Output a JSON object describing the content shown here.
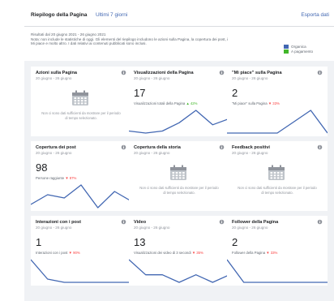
{
  "header": {
    "title": "Riepilogo della Pagina",
    "range": "Ultimi 7 giorni",
    "export": "Esporta dati"
  },
  "info": {
    "dates": "Risultati dal 20 giugno 2021 - 26 giugno 2021",
    "note": "Nota: non include le statistiche di oggi. Gli elementi del riepilogo includono le azioni sulla Pagina, la copertura dei post, i Mi piace e molto altro. I dati relativi ai contenuti pubblicati sono inclusi.",
    "legend_organic": "Organica",
    "legend_paid": "A pagamento",
    "color_organic": "#4267b2",
    "color_paid": "#42b72a"
  },
  "cards": [
    {
      "title": "Azioni sulla Pagina",
      "sub": "20 giugno - 26 giugno",
      "type": "empty",
      "empty_text": "Non ci sono dati sufficienti da mostrare per il periodo di tempo selezionato.",
      "trend": []
    },
    {
      "title": "Visualizzazioni della Pagina",
      "sub": "20 giugno - 26 giugno",
      "type": "value",
      "value": "17",
      "change_label": "Visualizzazioni totali della Pagina",
      "change_pct": "▲ 42%",
      "direction": "up",
      "trend": [
        6,
        5,
        6,
        10,
        16,
        9,
        12
      ]
    },
    {
      "title": "\"Mi piace\" sulla Pagina",
      "sub": "20 giugno - 26 giugno",
      "type": "value",
      "value": "2",
      "change_label": "\"Mi piace\" sulla Pagina",
      "change_pct": "▼ 33%",
      "direction": "down",
      "trend": [
        0,
        0,
        0,
        0,
        3,
        6,
        0
      ]
    },
    {
      "title": "Copertura dei post",
      "sub": "20 giugno - 26 giugno",
      "type": "value",
      "value": "98",
      "change_label": "Persone raggiunte",
      "change_pct": "▼ 87%",
      "direction": "down",
      "trend": [
        5,
        8,
        7,
        11,
        4,
        9,
        6
      ]
    },
    {
      "title": "Copertura della storia",
      "sub": "20 giugno - 26 giugno",
      "type": "empty",
      "empty_text": "Non ci sono dati sufficienti da mostrare per il periodo di tempo selezionato.",
      "trend": []
    },
    {
      "title": "Feedback positivi",
      "sub": "20 giugno - 26 giugno",
      "type": "empty",
      "empty_text": "Non ci sono dati sufficienti da mostrare per il periodo di tempo selezionato.",
      "trend": []
    },
    {
      "title": "Interazioni con i post",
      "sub": "20 giugno - 26 giugno",
      "type": "value",
      "value": "1",
      "change_label": "Interazioni con i post",
      "change_pct": "▼ 90%",
      "direction": "down",
      "trend": [
        7,
        1,
        0,
        0,
        0,
        0,
        0
      ]
    },
    {
      "title": "Video",
      "sub": "20 giugno - 26 giugno",
      "type": "value",
      "value": "13",
      "change_label": "Visualizzazioni dei video di 3 secondi",
      "change_pct": "▼ 35%",
      "direction": "down",
      "trend": [
        5,
        3,
        3,
        2,
        3,
        2,
        3
      ]
    },
    {
      "title": "Follower della Pagina",
      "sub": "20 giugno - 26 giugno",
      "type": "value",
      "value": "2",
      "change_label": "Follower della Pagina",
      "change_pct": "▼ 33%",
      "direction": "down",
      "trend": [
        6,
        0,
        0,
        0,
        0,
        0,
        0
      ]
    }
  ]
}
